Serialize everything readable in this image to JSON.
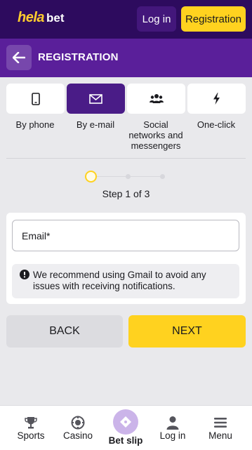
{
  "header": {
    "logo_part1": "hela",
    "logo_part2": "bet",
    "login_label": "Log in",
    "register_label": "Registration"
  },
  "title_bar": {
    "title": "REGISTRATION"
  },
  "tabs": [
    {
      "label": "By phone",
      "icon": "phone-icon",
      "active": false
    },
    {
      "label": "By e-mail",
      "icon": "envelope-icon",
      "active": true
    },
    {
      "label": "Social networks and messengers",
      "icon": "users-icon",
      "active": false
    },
    {
      "label": "One-click",
      "icon": "lightning-icon",
      "active": false
    }
  ],
  "stepper": {
    "text": "Step 1 of 3",
    "current": 1,
    "total": 3
  },
  "form": {
    "email_placeholder": "Email*",
    "email_value": "",
    "notice": "We recommend using Gmail to avoid any issues with receiving notifications."
  },
  "actions": {
    "back_label": "BACK",
    "next_label": "NEXT"
  },
  "bottom_nav": {
    "items": [
      {
        "label": "Sports",
        "icon": "trophy-icon"
      },
      {
        "label": "Casino",
        "icon": "chip-icon"
      },
      {
        "label": "Bet slip",
        "icon": "ticket-icon"
      },
      {
        "label": "Log in",
        "icon": "user-icon"
      },
      {
        "label": "Menu",
        "icon": "hamburger-icon"
      }
    ]
  },
  "colors": {
    "header_bg": "#2d0b5e",
    "title_bg": "#5a1f9a",
    "accent_yellow": "#ffd21f",
    "active_tab": "#4a1c87",
    "page_bg": "#e9e9ec"
  }
}
